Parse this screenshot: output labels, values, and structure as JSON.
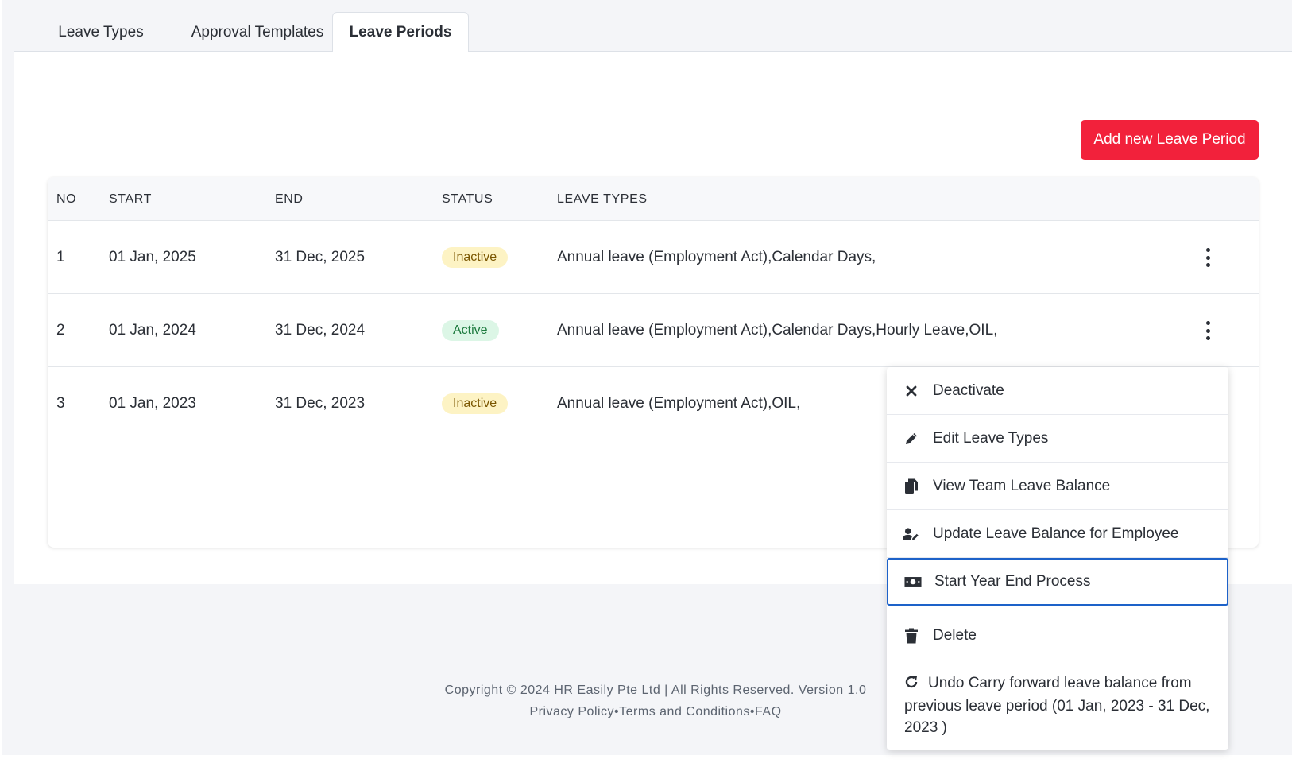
{
  "tabs": [
    {
      "label": "Leave Types"
    },
    {
      "label": "Approval Templates"
    },
    {
      "label": "Leave Periods"
    }
  ],
  "add_button_label": "Add new Leave Period",
  "table": {
    "headers": [
      "NO",
      "START",
      "END",
      "STATUS",
      "LEAVE TYPES"
    ],
    "rows": [
      {
        "no": "1",
        "start": "01 Jan, 2025",
        "end": "31 Dec, 2025",
        "status": "Inactive",
        "leave_types": "Annual leave (Employment Act),Calendar Days,"
      },
      {
        "no": "2",
        "start": "01 Jan, 2024",
        "end": "31 Dec, 2024",
        "status": "Active",
        "leave_types": "Annual leave (Employment Act),Calendar Days,Hourly Leave,OIL,"
      },
      {
        "no": "3",
        "start": "01 Jan, 2023",
        "end": "31 Dec, 2023",
        "status": "Inactive",
        "leave_types": "Annual leave (Employment Act),OIL,"
      }
    ]
  },
  "menu": {
    "items": [
      {
        "label": "Deactivate",
        "icon": "close-icon"
      },
      {
        "label": "Edit Leave Types",
        "icon": "pencil-icon"
      },
      {
        "label": "View Team Leave Balance",
        "icon": "copy-icon"
      },
      {
        "label": "Update Leave Balance for Employee",
        "icon": "user-edit-icon"
      },
      {
        "label": "Start Year End Process",
        "icon": "money-bill-icon"
      },
      {
        "label": "Delete",
        "icon": "trash-icon"
      },
      {
        "label": "Undo Carry forward leave balance from previous leave period (01 Jan, 2023 - 31 Dec, 2023 )",
        "icon": "undo-icon"
      }
    ]
  },
  "footer": {
    "copyright": "Copyright © 2024 HR Easily Pte Ltd | All Rights Reserved. Version 1.0",
    "privacy": "Privacy Policy",
    "sep": "•",
    "terms": "Terms and Conditions",
    "faq": "FAQ"
  },
  "colors": {
    "accent_red": "#f2213b",
    "selected_border": "#1d62c9",
    "inactive_badge_bg": "#fdf3c4",
    "active_badge_bg": "#dcf6e6"
  }
}
